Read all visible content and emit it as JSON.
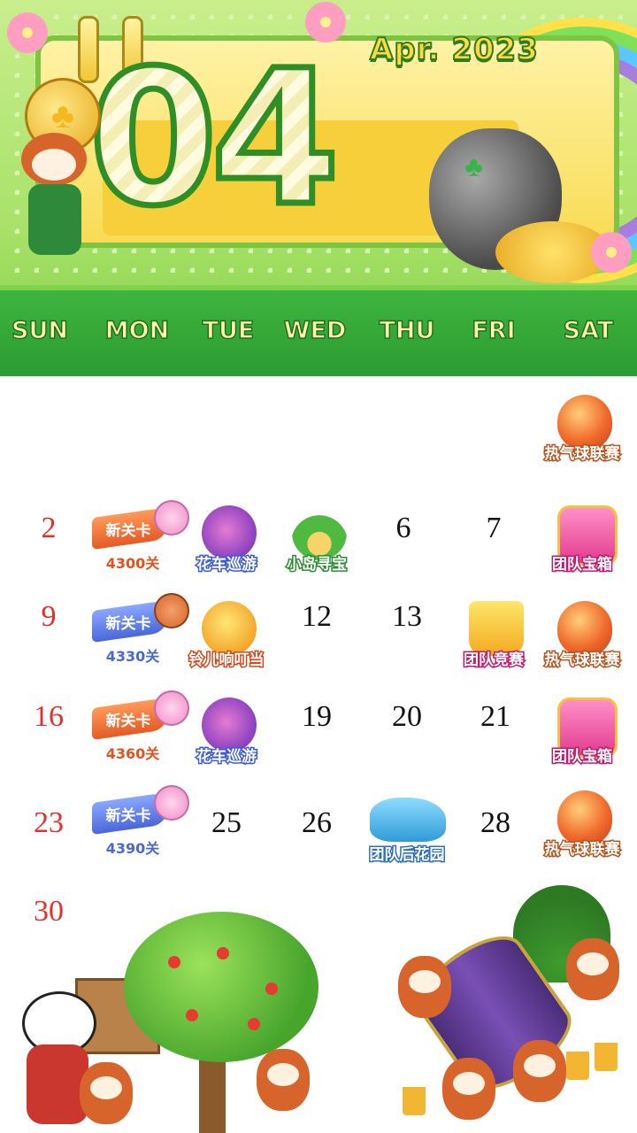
{
  "header": {
    "month_title": "Apr. 2023",
    "month_number": "04",
    "weekdays": [
      "SUN",
      "MON",
      "TUE",
      "WED",
      "THU",
      "FRI",
      "SAT"
    ]
  },
  "calendar": {
    "row1": {
      "sat_event": "热气球联赛"
    },
    "row2": {
      "sun": "2",
      "mon_ribbon": "新关卡",
      "mon_level": "4300关",
      "tue_event": "花车巡游",
      "wed_event": "小岛寻宝",
      "thu": "6",
      "fri": "7",
      "sat_event": "团队宝箱"
    },
    "row3": {
      "sun": "9",
      "mon_ribbon": "新关卡",
      "mon_level": "4330关",
      "tue_event": "铃儿响叮当",
      "wed": "12",
      "thu": "13",
      "fri_event": "团队竞赛",
      "sat_event": "热气球联赛"
    },
    "row4": {
      "sun": "16",
      "mon_ribbon": "新关卡",
      "mon_level": "4360关",
      "tue_event": "花车巡游",
      "wed": "19",
      "thu": "20",
      "fri": "21",
      "sat_event": "团队宝箱"
    },
    "row5": {
      "sun": "23",
      "mon_ribbon": "新关卡",
      "mon_level": "4390关",
      "tue": "25",
      "wed": "26",
      "thu_event": "团队后花园",
      "fri": "28",
      "sat_event": "热气球联赛"
    },
    "row6": {
      "sun": "30"
    }
  },
  "colors": {
    "sunday_red": "#e0312b",
    "header_green": "#2a9a33",
    "title_yellow": "#ffd93d"
  }
}
